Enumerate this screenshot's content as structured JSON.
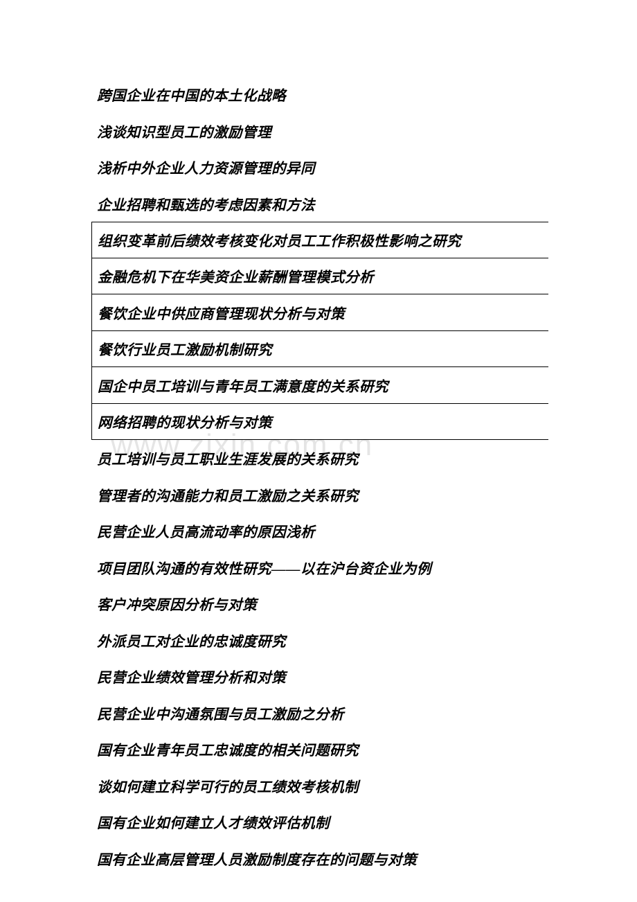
{
  "watermark": "www.zixin.com.cn",
  "topics": [
    {
      "text": "跨国企业在中国的本土化战略",
      "bordered": false
    },
    {
      "text": "浅谈知识型员工的激励管理",
      "bordered": false
    },
    {
      "text": "浅析中外企业人力资源管理的异同",
      "bordered": false
    },
    {
      "text": "企业招聘和甄选的考虑因素和方法",
      "bordered": false
    },
    {
      "text": "组织变革前后绩效考核变化对员工工作积极性影响之研究",
      "bordered": true,
      "borderedTop": true
    },
    {
      "text": "金融危机下在华美资企业薪酬管理模式分析",
      "bordered": true
    },
    {
      "text": "餐饮企业中供应商管理现状分析与对策",
      "bordered": true
    },
    {
      "text": "餐饮行业员工激励机制研究",
      "bordered": true
    },
    {
      "text": "国企中员工培训与青年员工满意度的关系研究",
      "bordered": true
    },
    {
      "text": "网络招聘的现状分析与对策",
      "bordered": true
    },
    {
      "text": "员工培训与员工职业生涯发展的关系研究",
      "bordered": false
    },
    {
      "text": "管理者的沟通能力和员工激励之关系研究",
      "bordered": false
    },
    {
      "text": "民营企业人员高流动率的原因浅析",
      "bordered": false
    },
    {
      "text": "项目团队沟通的有效性研究——以在沪台资企业为例",
      "bordered": false
    },
    {
      "text": "客户冲突原因分析与对策",
      "bordered": false
    },
    {
      "text": "外派员工对企业的忠诚度研究",
      "bordered": false
    },
    {
      "text": "民营企业绩效管理分析和对策",
      "bordered": false
    },
    {
      "text": "民营企业中沟通氛围与员工激励之分析",
      "bordered": false
    },
    {
      "text": "国有企业青年员工忠诚度的相关问题研究",
      "bordered": false
    },
    {
      "text": "谈如何建立科学可行的员工绩效考核机制",
      "bordered": false
    },
    {
      "text": "国有企业如何建立人才绩效评估机制",
      "bordered": false
    },
    {
      "text": "国有企业高层管理人员激励制度存在的问题与对策",
      "bordered": false
    }
  ]
}
